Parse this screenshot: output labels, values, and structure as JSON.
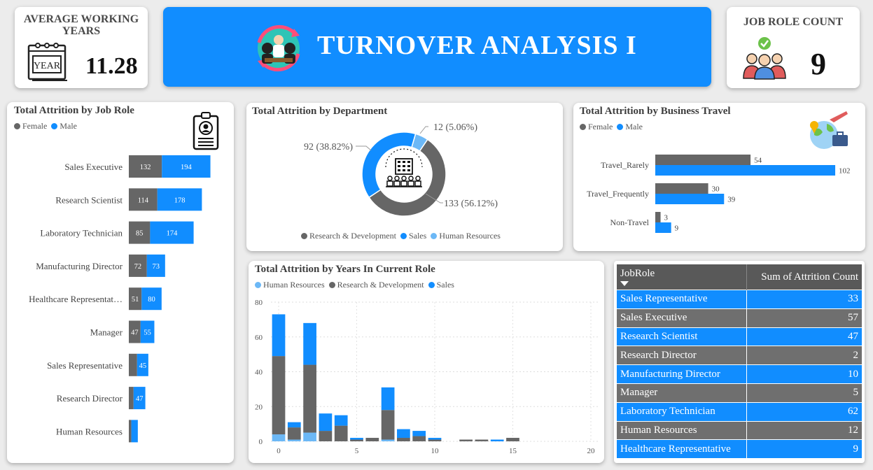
{
  "kpi_years": {
    "title": "AVERAGE WORKING YEARS",
    "value": "11.28",
    "icon": "year-calendar-icon",
    "icon_text": "YEAR"
  },
  "banner": {
    "title": "TURNOVER ANALYSIS I",
    "icon": "team-meeting-icon",
    "bg": "#118dff"
  },
  "kpi_roles": {
    "title": "JOB ROLE COUNT",
    "value": "9",
    "icon": "team-check-icon"
  },
  "colors": {
    "female": "#666666",
    "male": "#118dff",
    "hr": "#6cb8f6",
    "rd": "#666666",
    "sales": "#118dff"
  },
  "job_role_chart": {
    "title": "Total Attrition by Job Role",
    "legend": [
      "Female",
      "Male"
    ],
    "chart_data": {
      "type": "bar",
      "orientation": "horizontal-stacked",
      "categories": [
        "Sales Executive",
        "Research Scientist",
        "Laboratory Technician",
        "Manufacturing Director",
        "Healthcare Representat…",
        "Manager",
        "Sales Representative",
        "Research Director",
        "Human Resources"
      ],
      "series": [
        {
          "name": "Female",
          "values": [
            132,
            114,
            85,
            72,
            51,
            47,
            33,
            19,
            10
          ],
          "labels": [
            "132",
            "114",
            "85",
            "72",
            "51",
            "47",
            "",
            "",
            ""
          ]
        },
        {
          "name": "Male",
          "values": [
            194,
            178,
            174,
            73,
            80,
            55,
            45,
            47,
            26
          ],
          "labels": [
            "194",
            "178",
            "174",
            "73",
            "80",
            "55",
            "45",
            "47",
            ""
          ]
        }
      ]
    }
  },
  "department_chart": {
    "title": "Total Attrition by Department",
    "chart_data": {
      "type": "pie",
      "donut": true,
      "categories": [
        "Research & Development",
        "Sales",
        "Human Resources"
      ],
      "values": [
        133,
        92,
        12
      ],
      "labels": [
        "133 (56.12%)",
        "92 (38.82%)",
        "12 (5.06%)"
      ]
    },
    "legend": [
      "Research & Development",
      "Sales",
      "Human Resources"
    ]
  },
  "travel_chart": {
    "title": "Total Attrition by Business Travel",
    "legend": [
      "Female",
      "Male"
    ],
    "chart_data": {
      "type": "bar",
      "orientation": "horizontal-grouped",
      "categories": [
        "Travel_Rarely",
        "Travel_Frequently",
        "Non-Travel"
      ],
      "series": [
        {
          "name": "Female",
          "values": [
            54,
            30,
            3
          ]
        },
        {
          "name": "Male",
          "values": [
            102,
            39,
            9
          ]
        }
      ]
    }
  },
  "years_chart": {
    "title": "Total Attrition by Years In Current Role",
    "legend": [
      "Human Resources",
      "Research & Development",
      "Sales"
    ],
    "chart_data": {
      "type": "bar",
      "stacked": true,
      "x": [
        0,
        1,
        2,
        3,
        4,
        5,
        6,
        7,
        8,
        9,
        10,
        11,
        12,
        13,
        14,
        15
      ],
      "series": [
        {
          "name": "Human Resources",
          "values": [
            4,
            1,
            5,
            0,
            0,
            0,
            0,
            1,
            0,
            0,
            0,
            0,
            0,
            0,
            0,
            0
          ]
        },
        {
          "name": "Research & Development",
          "values": [
            45,
            7,
            39,
            6,
            9,
            1,
            2,
            17,
            2,
            3,
            1,
            0,
            1,
            1,
            0,
            2
          ]
        },
        {
          "name": "Sales",
          "values": [
            24,
            3,
            24,
            10,
            6,
            1,
            0,
            13,
            5,
            3,
            1,
            0,
            0,
            0,
            1,
            0
          ]
        }
      ],
      "xticks": [
        0,
        5,
        10,
        15,
        20
      ],
      "yticks": [
        0,
        20,
        40,
        60,
        80
      ],
      "xlim": [
        -0.5,
        20
      ],
      "ylim": [
        0,
        80
      ],
      "grid": true
    }
  },
  "table": {
    "headers": [
      "JobRole",
      "Sum of Attrition Count"
    ],
    "rows": [
      [
        "Sales Representative",
        "33"
      ],
      [
        "Sales Executive",
        "57"
      ],
      [
        "Research Scientist",
        "47"
      ],
      [
        "Research Director",
        "2"
      ],
      [
        "Manufacturing Director",
        "10"
      ],
      [
        "Manager",
        "5"
      ],
      [
        "Laboratory Technician",
        "62"
      ],
      [
        "Human Resources",
        "12"
      ],
      [
        "Healthcare Representative",
        "9"
      ]
    ]
  }
}
